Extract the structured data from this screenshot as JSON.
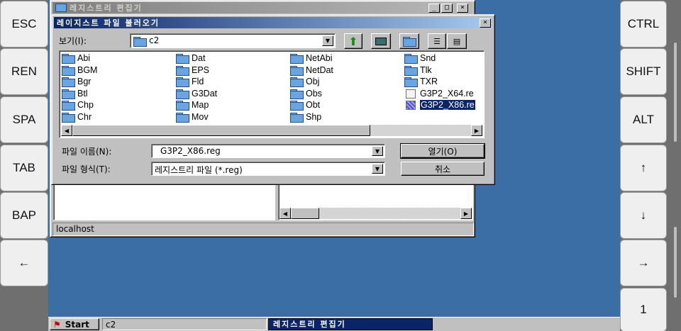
{
  "left_keys": [
    "ESC",
    "REN",
    "SPA",
    "TAB",
    "BAP",
    "←"
  ],
  "right_keys": [
    "CTRL",
    "SHIFT",
    "ALT",
    "↑",
    "↓",
    "→",
    "1"
  ],
  "regedit": {
    "title": "레지스트리 편집기",
    "status": "localhost",
    "min_label": "_",
    "max_label": "□",
    "close_label": "×"
  },
  "dialog": {
    "title": "레이지스트 파일 불러오기",
    "close_label": "×",
    "lookin_label": "보기(I):",
    "lookin_value": "c2",
    "filename_label": "파일 이름(N):",
    "filename_value": "G3P2_X86.reg",
    "filetype_label": "파일 형식(T):",
    "filetype_value": "레지스트리 파일 (*.reg)",
    "open_label": "열기(O)",
    "cancel_label": "취소",
    "columns": [
      [
        "Abi",
        "BGM",
        "Bgr",
        "Btl",
        "Chp",
        "Chr"
      ],
      [
        "Dat",
        "EPS",
        "Fld",
        "G3Dat",
        "Map",
        "Mov"
      ],
      [
        "NetAbi",
        "NetDat",
        "Obj",
        "Obs",
        "Obt",
        "Shp"
      ],
      [
        "Snd",
        "Tlk",
        "TXR"
      ]
    ],
    "files": [
      "G3P2_X64.re",
      "G3P2_X86.re"
    ]
  },
  "taskbar": {
    "start": "Start",
    "item1": "c2",
    "item2": "레지스트리 편집기"
  }
}
